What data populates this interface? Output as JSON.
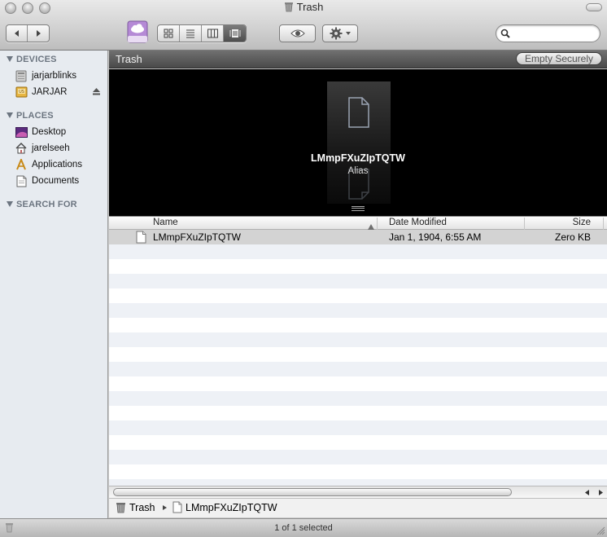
{
  "window": {
    "title": "Trash"
  },
  "toolbar": {
    "back_icon": "chevron-left-icon",
    "forward_icon": "chevron-right-icon",
    "view_modes": [
      "icon-view",
      "list-view",
      "column-view",
      "cover-flow-view"
    ],
    "active_view": "cover-flow-view",
    "quicklook_icon": "eye-icon",
    "action_icon": "gear-icon",
    "search": {
      "value": "",
      "placeholder": ""
    }
  },
  "sidebar": {
    "devices_header": "DEVICES",
    "devices": [
      {
        "label": "jarjarblinks",
        "icon": "computer-icon"
      },
      {
        "label": "JARJAR",
        "icon": "disk-icon",
        "ejectable": true
      }
    ],
    "places_header": "PLACES",
    "places": [
      {
        "label": "Desktop",
        "icon": "desktop-icon"
      },
      {
        "label": "jarelseeh",
        "icon": "home-icon"
      },
      {
        "label": "Applications",
        "icon": "applications-icon"
      },
      {
        "label": "Documents",
        "icon": "documents-icon"
      }
    ],
    "search_header": "SEARCH FOR"
  },
  "main": {
    "location": "Trash",
    "empty_button": "Empty Securely",
    "coverflow": {
      "name": "LMmpFXuZIpTQTW",
      "kind": "Alias"
    },
    "columns": {
      "name": "Name",
      "date": "Date Modified",
      "size": "Size"
    },
    "files": [
      {
        "name": "LMmpFXuZIpTQTW",
        "date": "Jan 1, 1904, 6:55 AM",
        "size": "Zero KB",
        "selected": true
      }
    ]
  },
  "pathbar": {
    "root": "Trash",
    "item": "LMmpFXuZIpTQTW"
  },
  "status": {
    "text": "1 of 1 selected"
  }
}
